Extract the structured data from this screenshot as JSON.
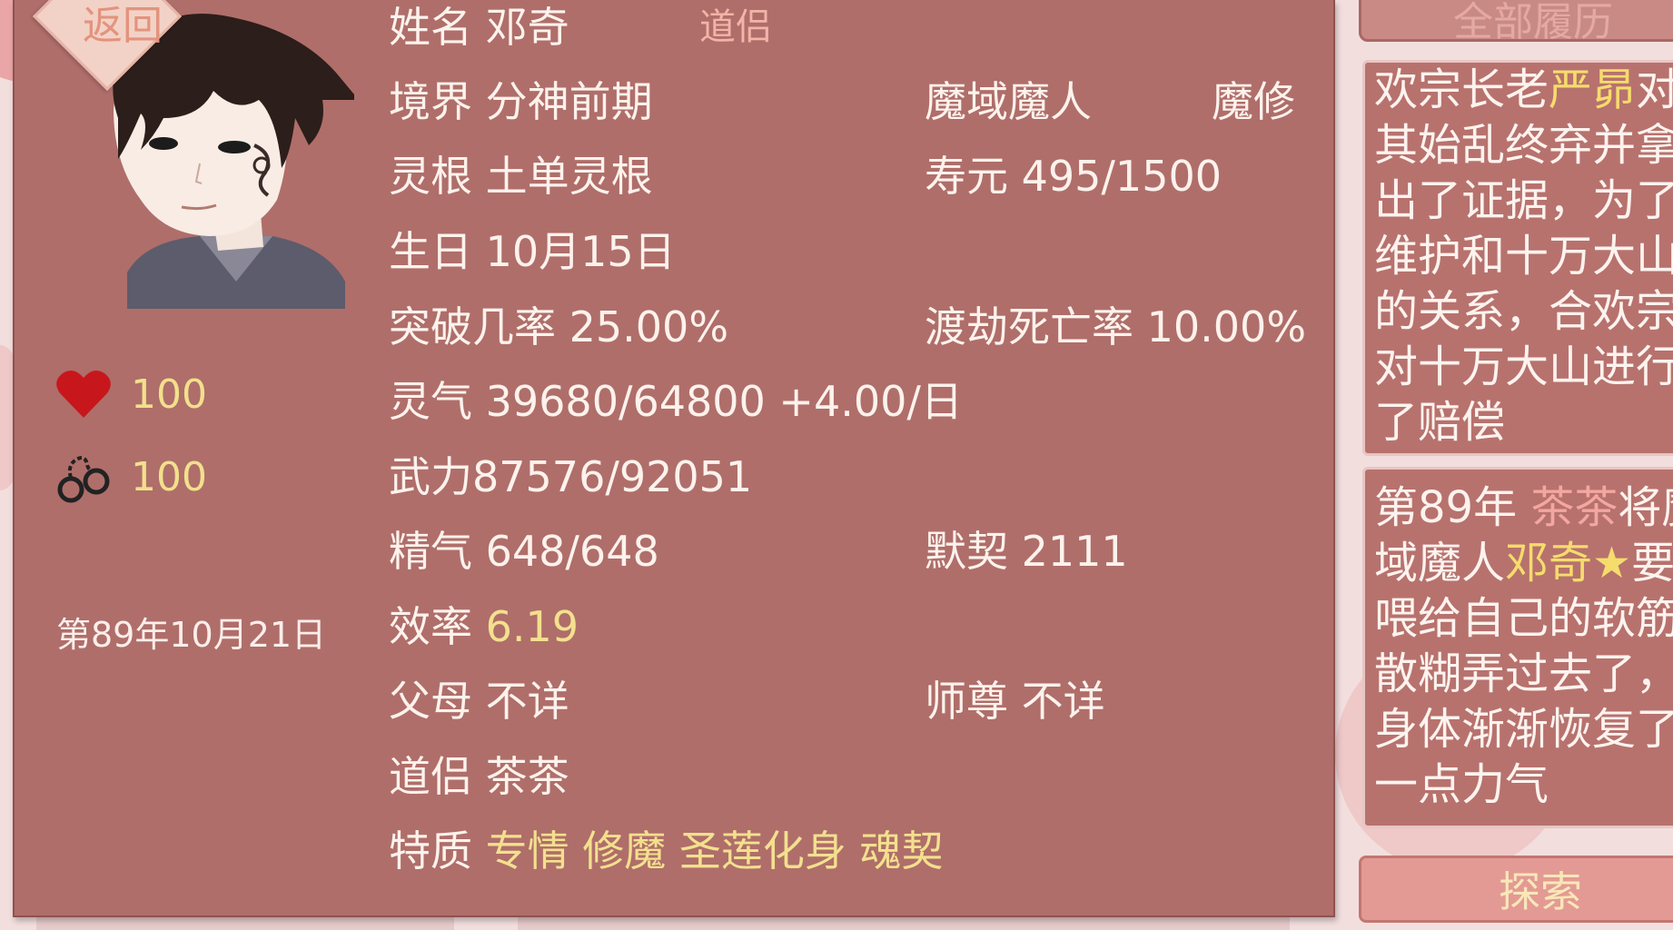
{
  "nav": {
    "back_label": "返回"
  },
  "profile": {
    "name_label": "姓名",
    "name": "邓奇",
    "relation_tag": "道侣",
    "realm_label": "境界",
    "realm": "分神前期",
    "race": "魔域魔人",
    "cultivation_type": "魔修",
    "root_label": "灵根",
    "root": "土单灵根",
    "lifespan_label": "寿元",
    "lifespan": "495/1500",
    "birthday_label": "生日",
    "birthday": "10月15日",
    "breakthrough_label": "突破几率",
    "breakthrough": "25.00%",
    "tribulation_label": "渡劫死亡率",
    "tribulation": "10.00%",
    "qi_label": "灵气",
    "qi": "39680/64800 +4.00/日",
    "force_label": "武力",
    "force": "87576/92051",
    "essence_label": "精气",
    "essence": "648/648",
    "tacit_label": "默契",
    "tacit": "2111",
    "efficiency_label": "效率",
    "efficiency": "6.19",
    "parents_label": "父母",
    "parents": "不详",
    "master_label": "师尊",
    "master": "不详",
    "partner_label": "道侣",
    "partner": "茶茶",
    "traits_label": "特质",
    "traits": [
      "专情",
      "修魔",
      "圣莲化身",
      "魂契"
    ]
  },
  "stats": {
    "health": "100",
    "restraint": "100",
    "date": "第89年10月21日"
  },
  "log": {
    "tab_label": "全部履历",
    "entry1_lines": [
      {
        "a": "欢宗长老",
        "b": "严昴",
        "c": "对"
      },
      {
        "a": "其始乱终弃并拿"
      },
      {
        "a": "出了证据，为了"
      },
      {
        "a": "维护和十万大山"
      },
      {
        "a": "的关系，合欢宗"
      },
      {
        "a": "对十万大山进行"
      },
      {
        "a": "了赔偿"
      }
    ],
    "entry2_lines": [
      {
        "a": "第89年 ",
        "b": "茶茶",
        "c": "将魔"
      },
      {
        "a": "域魔人",
        "b": "邓奇★",
        "c": "要"
      },
      {
        "a": "喂给自己的软筋"
      },
      {
        "a": "散糊弄过去了，"
      },
      {
        "a": "身体渐渐恢复了"
      },
      {
        "a": "一点力气"
      }
    ],
    "explore_label": "探索"
  },
  "colors": {
    "panel": "#af6e6a",
    "highlight_yellow": "#f3e08e",
    "highlight_pink": "#f4a6a0"
  },
  "icons": {
    "health": "heart-icon",
    "restraint": "handcuffs-icon"
  }
}
